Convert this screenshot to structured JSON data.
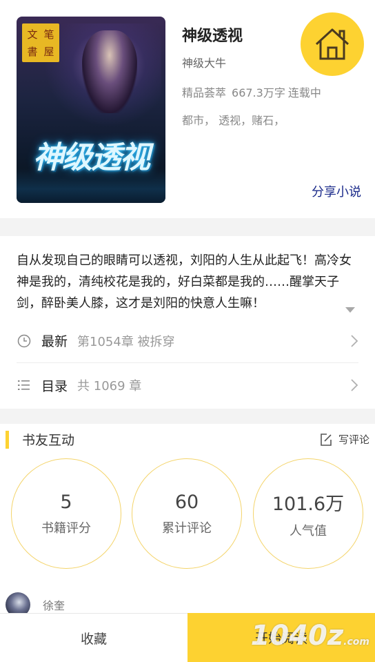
{
  "book": {
    "cover_seal": [
      "文",
      "笔",
      "書",
      "屋"
    ],
    "cover_title": "神级透视",
    "title": "神级透视",
    "author": "神级大牛",
    "category": "精品荟萃",
    "word_count": "667.3万字",
    "status": "连载中",
    "tags": "都市，  透视，赌石，",
    "share_label": "分享小说"
  },
  "synopsis": "自从发现自己的眼睛可以透视，刘阳的人生从此起飞！高冷女神是我的，清纯校花是我的，好白菜都是我的……醒掌天子剑，醉卧美人膝，这才是刘阳的快意人生嘛！",
  "latest": {
    "label": "最新",
    "value": "第1054章 被拆穿"
  },
  "catalog": {
    "label": "目录",
    "value": "共 1069 章"
  },
  "interaction": {
    "title": "书友互动",
    "write_review": "写评论",
    "stats": [
      {
        "value": "5",
        "label": "书籍评分"
      },
      {
        "value": "60",
        "label": "累计评论"
      },
      {
        "value": "101.6万",
        "label": "人气值"
      }
    ]
  },
  "commenter": {
    "name": "徐奎"
  },
  "bottom_bar": {
    "collect": "收藏",
    "read": "开始阅读"
  },
  "watermark": {
    "main": "1040",
    "suffix": "z",
    "domain": ".com"
  },
  "colors": {
    "accent": "#fdd231",
    "link": "#1a2a8a"
  }
}
